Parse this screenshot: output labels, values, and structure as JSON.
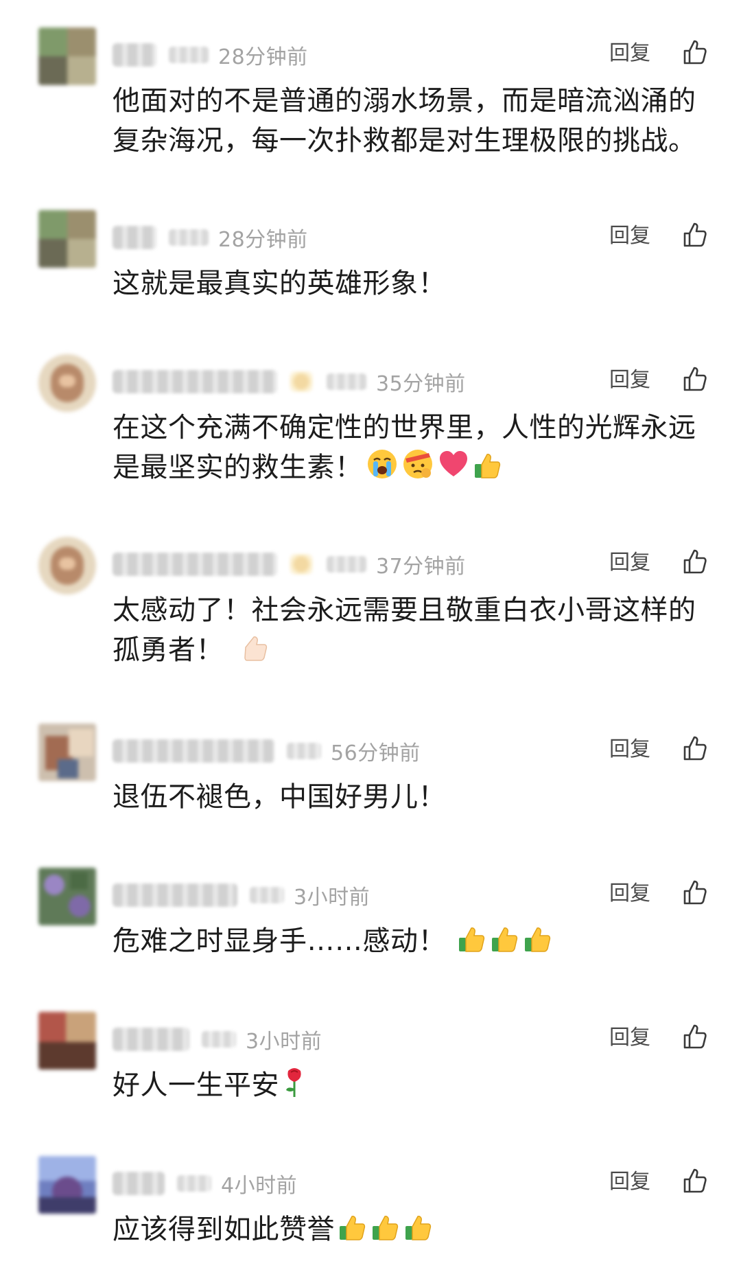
{
  "reply_label": "回复",
  "comments": [
    {
      "time": "28分钟前",
      "text": "他面对的不是普通的溺水场景，而是暗流汹涌的复杂海况，每一次扑救都是对生理极限的挑战。",
      "emoji": []
    },
    {
      "time": "28分钟前",
      "text": "这就是最真实的英雄形象！",
      "emoji": []
    },
    {
      "time": "35分钟前",
      "text": "在这个充满不确定性的世界里，人性的光辉永远是最坚实的救生素！",
      "emoji": [
        "crying-face-icon",
        "saluting-face-icon",
        "heart-icon",
        "thumbs-up-icon"
      ]
    },
    {
      "time": "37分钟前",
      "text": "太感动了！社会永远需要且敬重白衣小哥这样的孤勇者！",
      "emoji": [
        "thumbs-up-light-icon"
      ]
    },
    {
      "time": "56分钟前",
      "text": "退伍不褪色，中国好男儿！",
      "emoji": []
    },
    {
      "time": "3小时前",
      "text": "危难之时显身手……感动！",
      "emoji": [
        "thumbs-up-icon",
        "thumbs-up-icon",
        "thumbs-up-icon"
      ]
    },
    {
      "time": "3小时前",
      "text": "好人一生平安",
      "emoji": [
        "rose-icon"
      ]
    },
    {
      "time": "4小时前",
      "text": "应该得到如此赞誉",
      "emoji": [
        "thumbs-up-icon",
        "thumbs-up-icon",
        "thumbs-up-icon"
      ]
    }
  ]
}
